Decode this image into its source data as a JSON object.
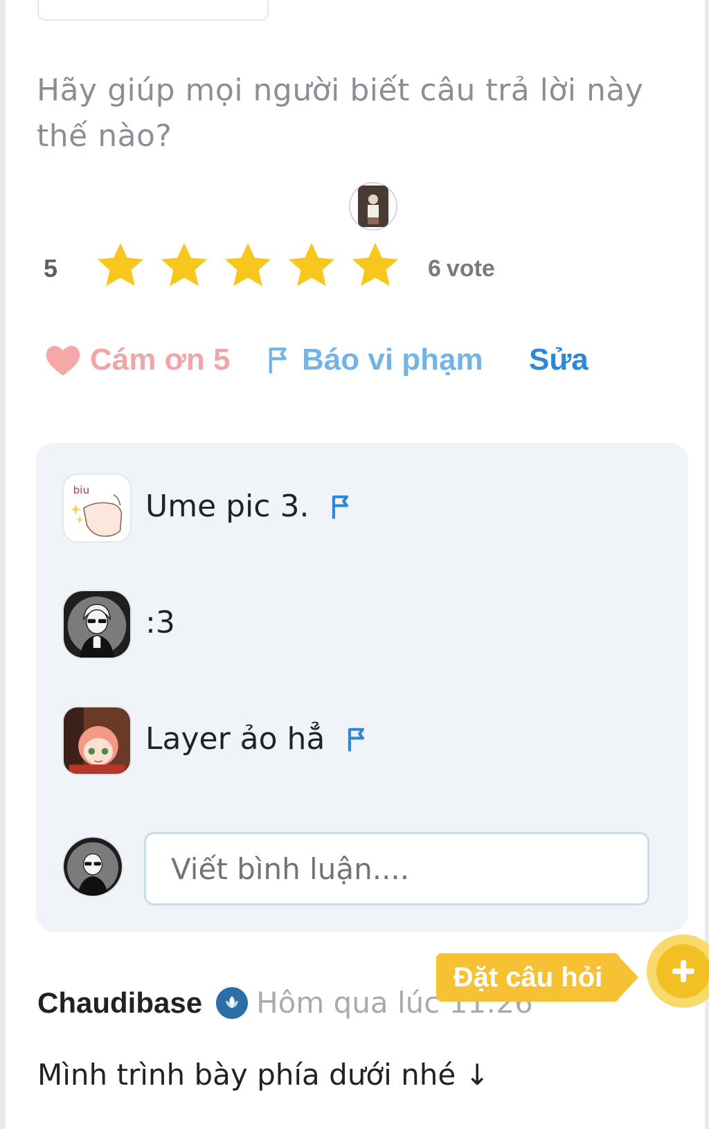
{
  "help_prompt": "Hãy giúp mọi người biết câu trả lời này thế nào?",
  "rating": {
    "average": "5",
    "stars_filled": 5,
    "stars_total": 5,
    "star_color": "#f6c81e",
    "vote_count": "6",
    "vote_label": "vote"
  },
  "actions": {
    "thanks_label": "Cám ơn 5",
    "report_label": "Báo vi phạm",
    "edit_label": "Sửa"
  },
  "comments": [
    {
      "text": "Ume pic 3.",
      "avatar": "biu-pointing-hand-sticker",
      "has_flag": true
    },
    {
      "text": ":3",
      "avatar": "sunglasses-boy-avatar",
      "has_flag": false
    },
    {
      "text": "Layer ảo hẳ",
      "avatar": "anime-girl-avatar",
      "has_flag": true
    }
  ],
  "comment_input": {
    "placeholder": "Viết bình luận...."
  },
  "ask_button": {
    "label": "Đặt câu hỏi",
    "fab_icon": "plus-icon"
  },
  "answer": {
    "author": "Chaudibase",
    "badge_icon": "leaf-badge-icon",
    "timestamp": "Hôm qua lúc 11:26",
    "text": "Mình trình bày phía dưới nhé ↓"
  },
  "colors": {
    "thanks": "#f0a6a6",
    "report": "#73b3e6",
    "edit": "#2e86d6",
    "ask": "#f6c233",
    "comment_bg": "#f0f3f8"
  }
}
